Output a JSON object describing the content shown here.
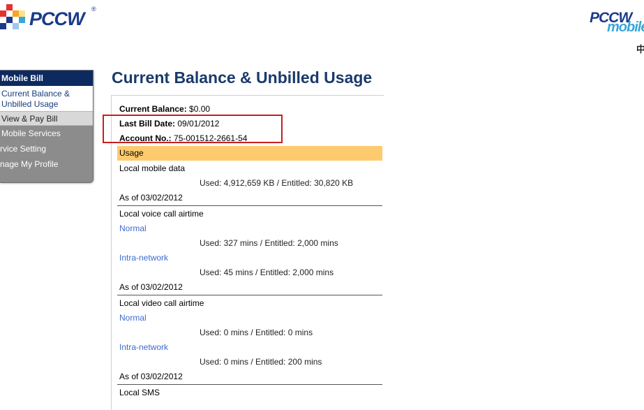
{
  "header": {
    "logo_left_text": "PCCW",
    "logo_left_mark": "®",
    "logo_right_top": "PCCW",
    "logo_right_bottom": "mobile",
    "lang_link": "中"
  },
  "sidebar": {
    "title": "Mobile Bill",
    "current_item": "Current Balance & Unbilled Usage",
    "items": [
      {
        "label": "View & Pay Bill"
      },
      {
        "label": "Mobile Services"
      },
      {
        "label": "rvice Setting"
      },
      {
        "label": "nage My Profile"
      }
    ]
  },
  "main": {
    "title": "Current Balance & Unbilled Usage",
    "balance_label": "Current Balance:",
    "balance_value": "$0.00",
    "last_bill_label": "Last Bill Date:",
    "last_bill_value": "09/01/2012",
    "account_label": "Account No.:",
    "account_value": "75-001512-2661-54",
    "usage_header": "Usage",
    "sections": [
      {
        "title": "Local mobile data",
        "used": "Used: 4,912,659 KB / Entitled: 30,820 KB",
        "as_of": "As of 03/02/2012"
      },
      {
        "title": "Local voice call airtime",
        "normal_label": "Normal",
        "normal_used": "Used: 327 mins / Entitled: 2,000 mins",
        "intra_label": "Intra-network",
        "intra_used": "Used: 45 mins / Entitled: 2,000 mins",
        "as_of": "As of 03/02/2012"
      },
      {
        "title": "Local video call airtime",
        "normal_label": "Normal",
        "normal_used": "Used: 0 mins / Entitled: 0 mins",
        "intra_label": "Intra-network",
        "intra_used": "Used: 0 mins / Entitled: 200 mins",
        "as_of": "As of 03/02/2012"
      },
      {
        "title": "Local SMS"
      }
    ]
  },
  "colors": {
    "brand_navy": "#1a3a8a",
    "brand_cyan": "#3aa6d8",
    "usage_bar": "#fdcb6e",
    "link_blue": "#3d6bd0",
    "highlight_red": "#c81e1e"
  }
}
